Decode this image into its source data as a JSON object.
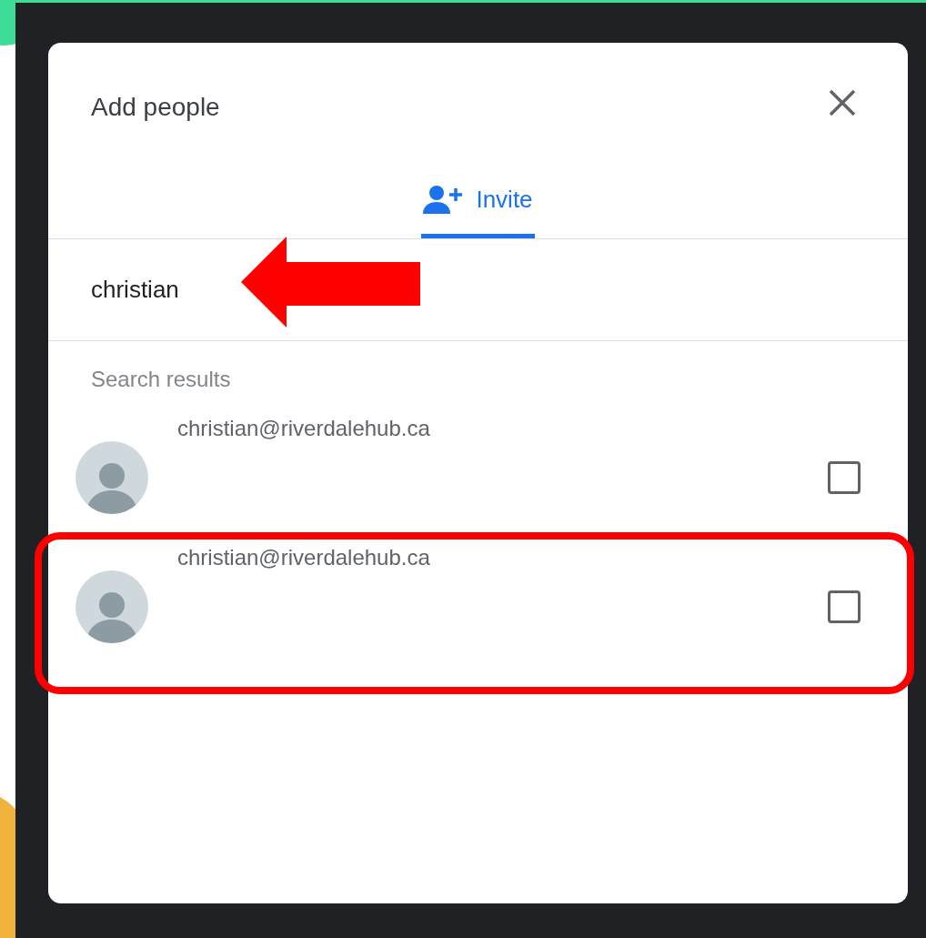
{
  "dialog": {
    "title": "Add people"
  },
  "tabs": [
    {
      "label": "Invite",
      "selected": true
    }
  ],
  "search": {
    "value": "christian"
  },
  "results": {
    "heading": "Search results",
    "items": [
      {
        "email": "christian@riverdalehub.ca",
        "checked": false
      },
      {
        "email": "christian@riverdalehub.ca",
        "checked": false
      }
    ]
  }
}
